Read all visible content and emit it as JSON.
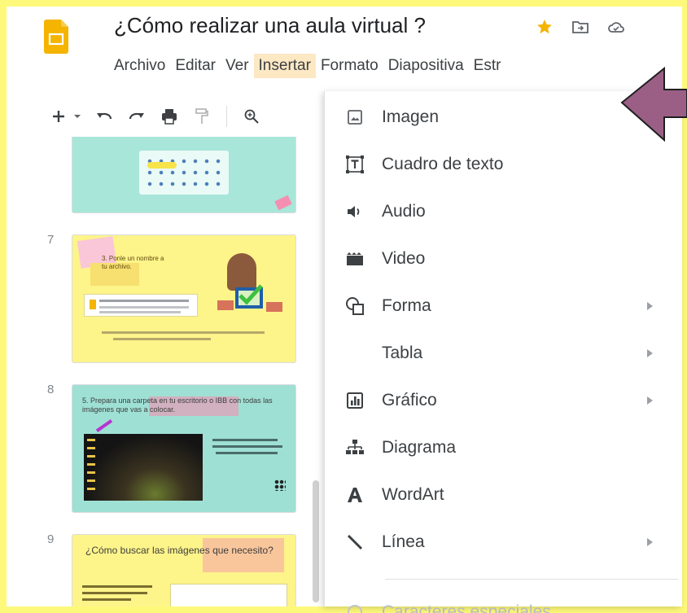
{
  "window": {
    "title": "¿Cómo realizar  una aula virtual ?",
    "app_icon": "google-slides-logo"
  },
  "title_icons": [
    "star-icon",
    "move-to-folder-icon",
    "cloud-status-icon"
  ],
  "menubar": {
    "items": [
      {
        "label": "Archivo",
        "active": false
      },
      {
        "label": "Editar",
        "active": false
      },
      {
        "label": "Ver",
        "active": false
      },
      {
        "label": "Insertar",
        "active": true
      },
      {
        "label": "Formato",
        "active": false
      },
      {
        "label": "Diapositiva",
        "active": false
      },
      {
        "label": "Estr",
        "active": false
      }
    ]
  },
  "toolbar": {
    "icons": [
      "new-slide-icon",
      "dropdown-caret-icon",
      "undo-icon",
      "redo-icon",
      "print-icon",
      "paint-format-icon",
      "zoom-icon"
    ]
  },
  "filmstrip": {
    "slides": [
      {
        "number": "7",
        "text": "3. Ponle un nombre a tu archivo."
      },
      {
        "number": "8",
        "text": "5. Prepara una carpeta en tu escritorio o IBB con todas las imágenes que vas a colocar."
      },
      {
        "number": "9",
        "text": "¿Cómo buscar las imágenes que necesito?"
      }
    ]
  },
  "insert_menu": {
    "items": [
      {
        "label": "Imagen",
        "icon": "image-icon",
        "submenu": false
      },
      {
        "label": "Cuadro de texto",
        "icon": "text-box-icon",
        "submenu": false
      },
      {
        "label": "Audio",
        "icon": "audio-icon",
        "submenu": false
      },
      {
        "label": "Video",
        "icon": "video-icon",
        "submenu": false
      },
      {
        "label": "Forma",
        "icon": "shape-icon",
        "submenu": true
      },
      {
        "label": "Tabla",
        "icon": "",
        "submenu": true
      },
      {
        "label": "Gráfico",
        "icon": "chart-icon",
        "submenu": true
      },
      {
        "label": "Diagrama",
        "icon": "diagram-icon",
        "submenu": false
      },
      {
        "label": "WordArt",
        "icon": "wordart-icon",
        "submenu": false
      },
      {
        "label": "Línea",
        "icon": "line-icon",
        "submenu": true
      },
      {
        "label": "Caracteres especiales",
        "icon": "special-characters-icon",
        "submenu": false
      }
    ]
  },
  "colors": {
    "frame": "#fef97a",
    "menu_active": "#fde8c4",
    "pointer_arrow": "#9b5f86",
    "slides_logo": "#f4b400"
  }
}
